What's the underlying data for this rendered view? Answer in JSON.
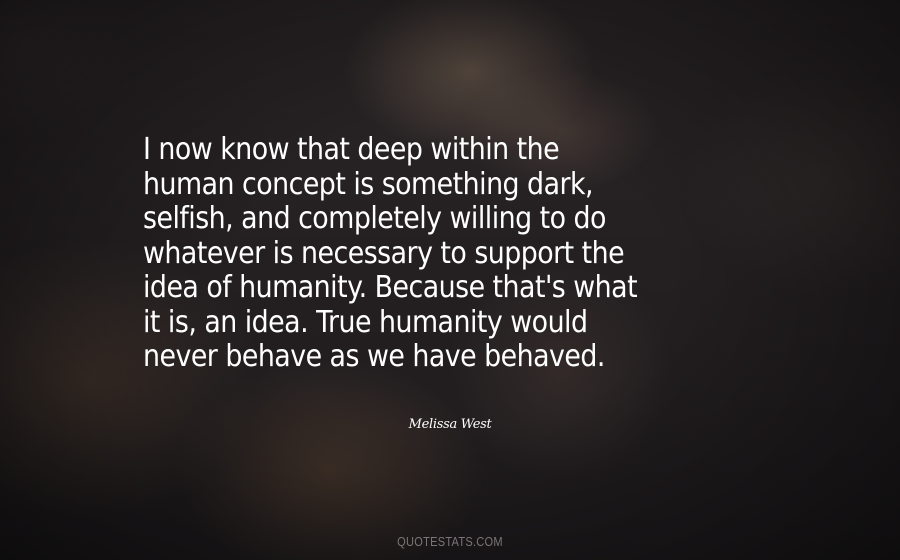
{
  "quote": {
    "lines": [
      "I now know that deep within the",
      "human concept is something dark,",
      "selfish, and completely willing to do",
      "whatever is necessary to support the",
      "idea of humanity. Because that's what",
      "it is, an idea. True humanity would",
      "never behave as we have behaved."
    ]
  },
  "author": "Melissa West",
  "footer": "QUOTESTATS.COM",
  "colors": {
    "text": "#ffffff",
    "footer_text": "#7a7578",
    "background": "#231f21"
  }
}
